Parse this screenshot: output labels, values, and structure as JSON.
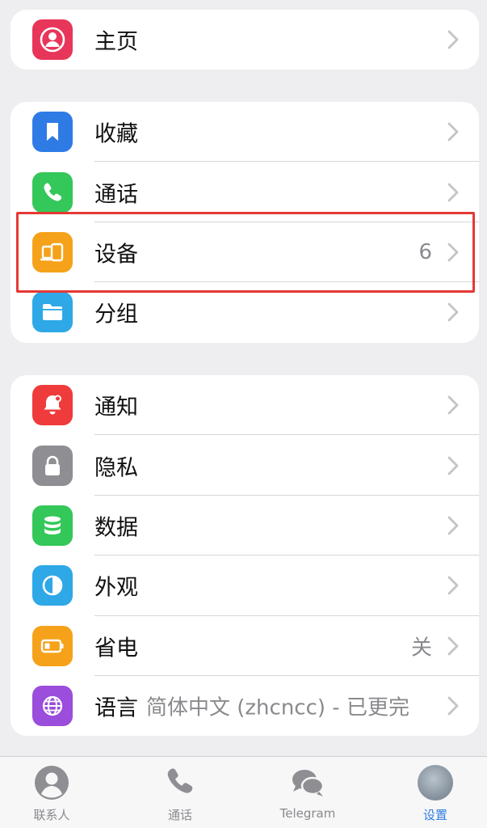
{
  "groups": [
    {
      "items": [
        {
          "label": "主页",
          "icon": "person-icon",
          "color": "#e8355a",
          "detail": ""
        }
      ]
    },
    {
      "items": [
        {
          "label": "收藏",
          "icon": "bookmark-icon",
          "color": "#2f7be6",
          "detail": ""
        },
        {
          "label": "通话",
          "icon": "phone-icon",
          "color": "#34c759",
          "detail": ""
        },
        {
          "label": "设备",
          "icon": "devices-icon",
          "color": "#f5a21a",
          "detail": "6"
        },
        {
          "label": "分组",
          "icon": "folder-icon",
          "color": "#2ea8e6",
          "detail": ""
        }
      ]
    },
    {
      "items": [
        {
          "label": "通知",
          "icon": "bell-icon",
          "color": "#ef3b3b",
          "detail": ""
        },
        {
          "label": "隐私",
          "icon": "lock-icon",
          "color": "#8e8e93",
          "detail": ""
        },
        {
          "label": "数据",
          "icon": "database-icon",
          "color": "#34c759",
          "detail": ""
        },
        {
          "label": "外观",
          "icon": "appearance-icon",
          "color": "#2ea8e6",
          "detail": ""
        },
        {
          "label": "省电",
          "icon": "battery-icon",
          "color": "#f5a21a",
          "detail": "关"
        },
        {
          "label": "语言",
          "icon": "globe-icon",
          "color": "#9b4ddb",
          "detail": "简体中文 (zhcncc) - 已更完"
        }
      ]
    }
  ],
  "tabbar": {
    "tabs": [
      {
        "label": "联系人",
        "icon": "contacts-icon",
        "active": false
      },
      {
        "label": "通话",
        "icon": "phone-icon",
        "active": false
      },
      {
        "label": "Telegram",
        "icon": "chats-icon",
        "active": false
      },
      {
        "label": "设置",
        "icon": "avatar",
        "active": true
      }
    ],
    "active_color": "#2f7ee0"
  },
  "highlight_color": "#e53935"
}
